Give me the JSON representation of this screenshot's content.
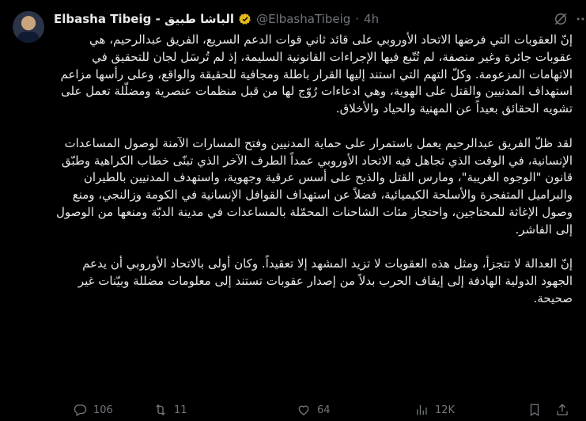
{
  "author": {
    "name": "Elbasha Tibeig - الباشا طبيق",
    "handle": "@ElbashaTibeig",
    "separator": "·",
    "time": "4h"
  },
  "tweet": {
    "paragraphs": [
      "إنّ العقوبات التي فرضها الاتحاد الأوروبي على قائد ثاني قوات الدعم السريع، الفريق عبدالرحيم، هي عقوبات جائرة وغير منصفة، لم تُتّبع فيها الإجراءات القانونية السليمة، إذ لم تُرسَل لجان للتحقيق في الاتهامات المزعومة. وكلّ التهم التي استند إليها القرار باطلة ومجافية للحقيقة والواقع، وعلى رأسها مزاعم استهداف المدنيين والقتل على الهوية، وهي ادعاءات رُوّج لها من قبل منظمات عنصرية ومضلّلة تعمل على تشويه الحقائق بعيداً عن المهنية والحياد والأخلاق.",
      "لقد ظلّ الفريق عبدالرحيم يعمل باستمرار على حماية المدنيين وفتح المسارات الآمنة لوصول المساعدات الإنسانية، في الوقت الذي تجاهل فيه الاتحاد الأوروبي عمداً الطرف الآخر الذي تبنّى خطاب الكراهية وطبّق قانون \"الوجوه الغريبة\"، ومارس القتل والذبح على أسس عرقية وجهوية، واستهدف المدنيين بالطيران والبراميل المتفجرة والأسلحة الكيميائية، فضلاً عن استهداف القوافل الإنسانية في الكومة وزالنجي، ومنع وصول الإغاثة للمحتاجين، واحتجاز مئات الشاحنات المحمّلة بالمساعدات في مدينة الدبّة ومنعها من الوصول إلى الفاشر.",
      "إنّ العدالة لا تتجزأ، ومثل هذه العقوبات لا تزيد المشهد إلا تعقيداً. وكان أولى بالاتحاد الأوروبي أن يدعم الجهود الدولية الهادفة إلى إيقاف الحرب بدلاً من إصدار عقوبات تستند إلى معلومات مضللة وبيّنات غير صحيحة."
    ]
  },
  "actions": {
    "replies": "106",
    "reposts": "11",
    "likes": "64",
    "views": "12K"
  },
  "colors": {
    "background": "#000000",
    "text": "#e7e9ea",
    "muted": "#71767b",
    "verified_badge": "#e2b719"
  }
}
